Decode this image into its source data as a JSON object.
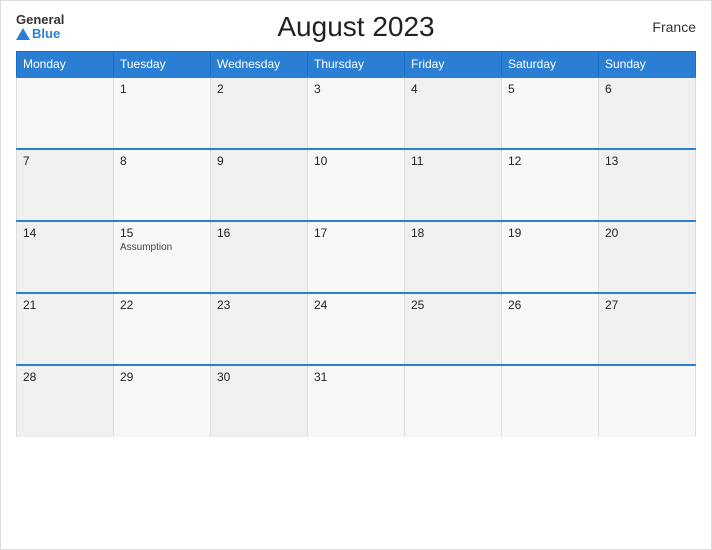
{
  "header": {
    "logo_general": "General",
    "logo_blue": "Blue",
    "title": "August 2023",
    "country": "France"
  },
  "days_of_week": [
    "Monday",
    "Tuesday",
    "Wednesday",
    "Thursday",
    "Friday",
    "Saturday",
    "Sunday"
  ],
  "weeks": [
    [
      {
        "day": "",
        "event": ""
      },
      {
        "day": "1",
        "event": ""
      },
      {
        "day": "2",
        "event": ""
      },
      {
        "day": "3",
        "event": ""
      },
      {
        "day": "4",
        "event": ""
      },
      {
        "day": "5",
        "event": ""
      },
      {
        "day": "6",
        "event": ""
      }
    ],
    [
      {
        "day": "7",
        "event": ""
      },
      {
        "day": "8",
        "event": ""
      },
      {
        "day": "9",
        "event": ""
      },
      {
        "day": "10",
        "event": ""
      },
      {
        "day": "11",
        "event": ""
      },
      {
        "day": "12",
        "event": ""
      },
      {
        "day": "13",
        "event": ""
      }
    ],
    [
      {
        "day": "14",
        "event": ""
      },
      {
        "day": "15",
        "event": "Assumption"
      },
      {
        "day": "16",
        "event": ""
      },
      {
        "day": "17",
        "event": ""
      },
      {
        "day": "18",
        "event": ""
      },
      {
        "day": "19",
        "event": ""
      },
      {
        "day": "20",
        "event": ""
      }
    ],
    [
      {
        "day": "21",
        "event": ""
      },
      {
        "day": "22",
        "event": ""
      },
      {
        "day": "23",
        "event": ""
      },
      {
        "day": "24",
        "event": ""
      },
      {
        "day": "25",
        "event": ""
      },
      {
        "day": "26",
        "event": ""
      },
      {
        "day": "27",
        "event": ""
      }
    ],
    [
      {
        "day": "28",
        "event": ""
      },
      {
        "day": "29",
        "event": ""
      },
      {
        "day": "30",
        "event": ""
      },
      {
        "day": "31",
        "event": ""
      },
      {
        "day": "",
        "event": ""
      },
      {
        "day": "",
        "event": ""
      },
      {
        "day": "",
        "event": ""
      }
    ]
  ]
}
